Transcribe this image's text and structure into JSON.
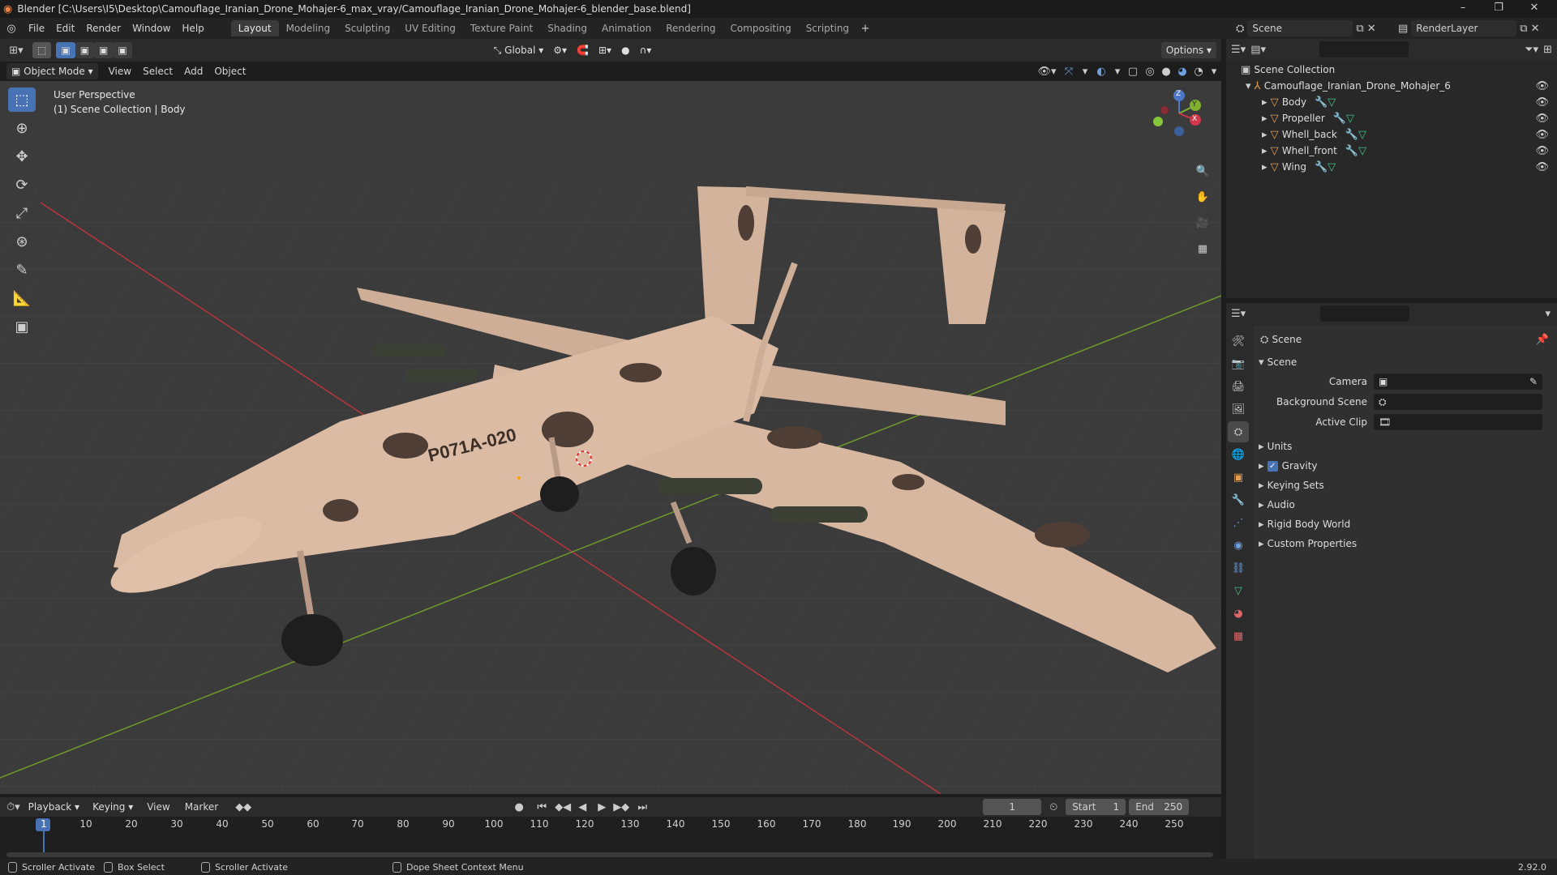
{
  "window": {
    "title": "Blender [C:\\Users\\I5\\Desktop\\Camouflage_Iranian_Drone_Mohajer-6_max_vray/Camouflage_Iranian_Drone_Mohajer-6_blender_base.blend]",
    "controls": [
      "–",
      "❐",
      "✕"
    ]
  },
  "menu": [
    "File",
    "Edit",
    "Render",
    "Window",
    "Help"
  ],
  "workspaces": [
    "Layout",
    "Modeling",
    "Sculpting",
    "UV Editing",
    "Texture Paint",
    "Shading",
    "Animation",
    "Rendering",
    "Compositing",
    "Scripting"
  ],
  "active_workspace": "Layout",
  "scene_name": "Scene",
  "view_layer": "RenderLayer",
  "viewport": {
    "mode": "Object Mode",
    "menus": [
      "View",
      "Select",
      "Add",
      "Object"
    ],
    "transform_orientation": "Global",
    "options_label": "Options",
    "overlay_line1": "User Perspective",
    "overlay_line2": "(1) Scene Collection | Body",
    "tail_number": "P071A-020",
    "gizmo": {
      "x": "X",
      "y": "Y",
      "z": "Z"
    }
  },
  "outliner": {
    "root": "Scene Collection",
    "collection": "Camouflage_Iranian_Drone_Mohajer_6",
    "items": [
      "Body",
      "Propeller",
      "Whell_back",
      "Whell_front",
      "Wing"
    ]
  },
  "properties": {
    "breadcrumb": "Scene",
    "panel_title": "Scene",
    "fields": [
      {
        "label": "Camera",
        "value": ""
      },
      {
        "label": "Background Scene",
        "value": ""
      },
      {
        "label": "Active Clip",
        "value": ""
      }
    ],
    "subpanels": [
      "Units",
      "Gravity",
      "Keying Sets",
      "Audio",
      "Rigid Body World",
      "Custom Properties"
    ],
    "gravity_checked": true
  },
  "timeline": {
    "menus": [
      "Playback",
      "Keying",
      "View",
      "Marker"
    ],
    "current_frame": "1",
    "start_label": "Start",
    "start": "1",
    "end_label": "End",
    "end": "250",
    "ticks": [
      "1",
      "10",
      "20",
      "30",
      "40",
      "50",
      "60",
      "70",
      "80",
      "90",
      "100",
      "110",
      "120",
      "130",
      "140",
      "150",
      "160",
      "170",
      "180",
      "190",
      "200",
      "210",
      "220",
      "230",
      "240",
      "250"
    ]
  },
  "statusbar": {
    "items": [
      "Scroller Activate",
      "Box Select",
      "Scroller Activate",
      "Dope Sheet Context Menu"
    ],
    "version": "2.92.0"
  },
  "colors": {
    "accent": "#4772b3",
    "drone_body": "#d8b7a0",
    "camo": "#4e3e35",
    "axis_red": "#b8353f",
    "axis_green": "#6f9a2a"
  }
}
